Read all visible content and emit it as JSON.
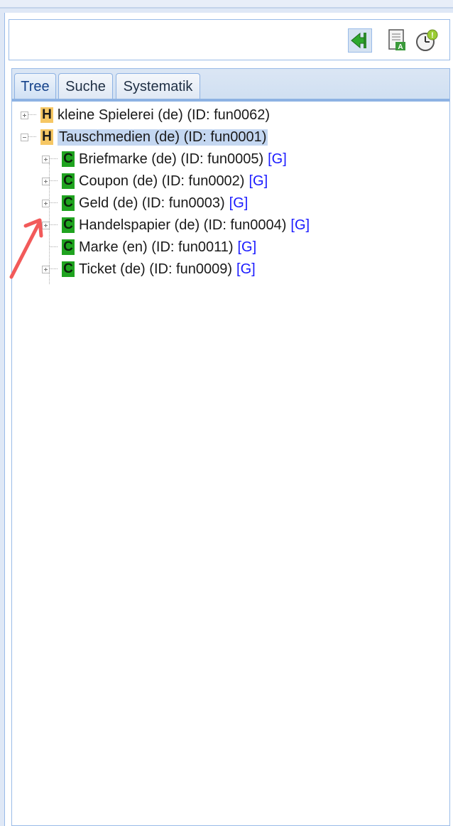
{
  "tabs": [
    "Tree",
    "Suche",
    "Systematik"
  ],
  "toolbar": {
    "icons": [
      "back-arrow-icon",
      "document-icon",
      "clock-alert-icon"
    ],
    "accent": "#2ea82e"
  },
  "tree": [
    {
      "badge": "H",
      "label": "kleine Spielerei (de) (ID: fun0062)",
      "toggle": "plus",
      "depth": 0
    },
    {
      "badge": "H",
      "label": "Tauschmedien (de) (ID: fun0001)",
      "toggle": "minus",
      "depth": 0,
      "selected": true
    },
    {
      "badge": "C",
      "label": "Briefmarke (de) (ID: fun0005)",
      "link": "[G]",
      "toggle": "plus",
      "depth": 1
    },
    {
      "badge": "C",
      "label": "Coupon (de) (ID: fun0002)",
      "link": "[G]",
      "toggle": "plus",
      "depth": 1
    },
    {
      "badge": "C",
      "label": "Geld (de) (ID: fun0003)",
      "link": "[G]",
      "toggle": "plus",
      "depth": 1
    },
    {
      "badge": "C",
      "label": "Handelspapier (de) (ID: fun0004)",
      "link": "[G]",
      "toggle": "plus",
      "depth": 1
    },
    {
      "badge": "C",
      "label": "Marke (en) (ID: fun0011)",
      "link": "[G]",
      "toggle": "none",
      "depth": 1
    },
    {
      "badge": "C",
      "label": "Ticket (de) (ID: fun0009)",
      "link": "[G]",
      "toggle": "plus",
      "depth": 1
    }
  ],
  "annotation": {
    "icon": "red-arrow-icon",
    "color": "#f25a5a"
  }
}
